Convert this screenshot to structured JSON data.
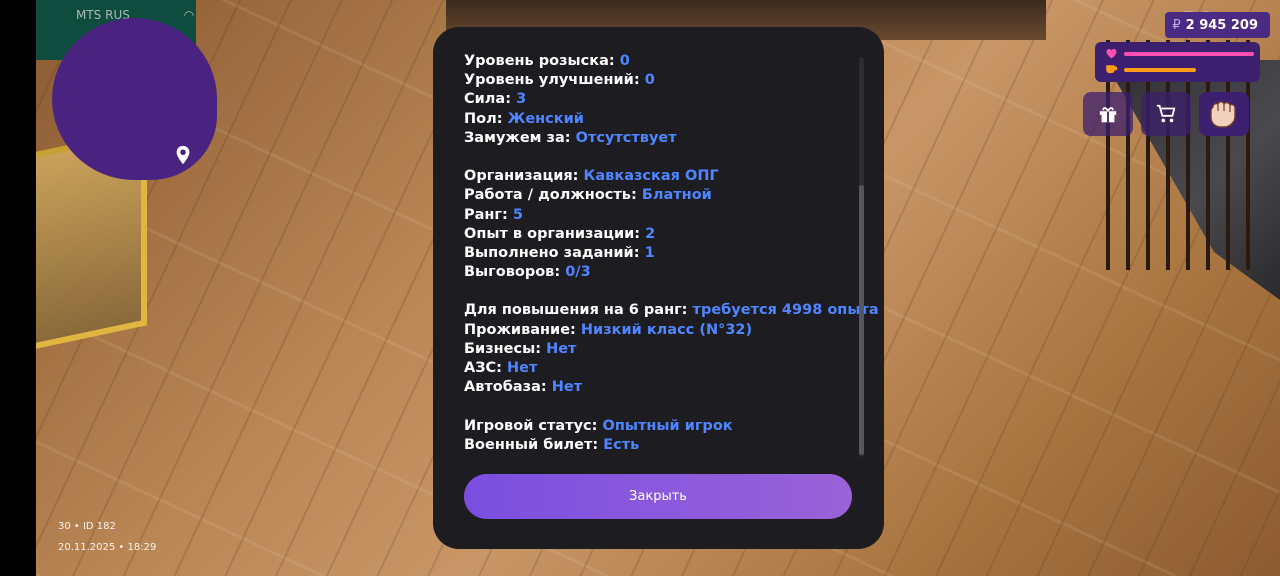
{
  "status_bar": {
    "carrier": "MTS RUS"
  },
  "hud": {
    "money": "2 945 209",
    "currency_symbol": "₽",
    "health_level": 1.0,
    "hunger_level": 0.55,
    "colors": {
      "health": "#ff4fb0",
      "hunger": "#ff9c1a",
      "panel": "#3c1f6e",
      "accent_value": "#4f86ff"
    },
    "buttons": [
      {
        "name": "gift-button",
        "icon": "gift-icon"
      },
      {
        "name": "shop-button",
        "icon": "cart-icon"
      },
      {
        "name": "fist-button",
        "icon": "fist-icon"
      }
    ]
  },
  "footer": {
    "player": "30 • ID 182",
    "datetime": "20.11.2025 • 18:29"
  },
  "dialog": {
    "rows": [
      {
        "label": "Уровень розыска:",
        "value": "0"
      },
      {
        "label": "Уровень улучшений:",
        "value": "0"
      },
      {
        "label": "Сила:",
        "value": "3"
      },
      {
        "label": "Пол:",
        "value": "Женский"
      },
      {
        "label": "Замужем за:",
        "value": "Отсутствует"
      },
      {
        "label": "Организация:",
        "value": "Кавказская ОПГ"
      },
      {
        "label": "Работа / должность:",
        "value": "Блатной"
      },
      {
        "label": "Ранг:",
        "value": "5"
      },
      {
        "label": "Опыт в организации:",
        "value": "2"
      },
      {
        "label": "Выполнено заданий:",
        "value": "1"
      },
      {
        "label": "Выговоров:",
        "value": "0/3"
      },
      {
        "label": "Для повышения на 6 ранг:",
        "value": "требуется 4998 опыта"
      },
      {
        "label": "Проживание:",
        "value": "Низкий класс (N°32)"
      },
      {
        "label": "Бизнесы:",
        "value": "Нет"
      },
      {
        "label": "АЗС:",
        "value": "Нет"
      },
      {
        "label": "Автобаза:",
        "value": "Нет"
      },
      {
        "label": "Игровой статус:",
        "value": "Опытный игрок"
      },
      {
        "label": "Военный билет:",
        "value": "Есть"
      }
    ],
    "close_label": "Закрыть"
  }
}
